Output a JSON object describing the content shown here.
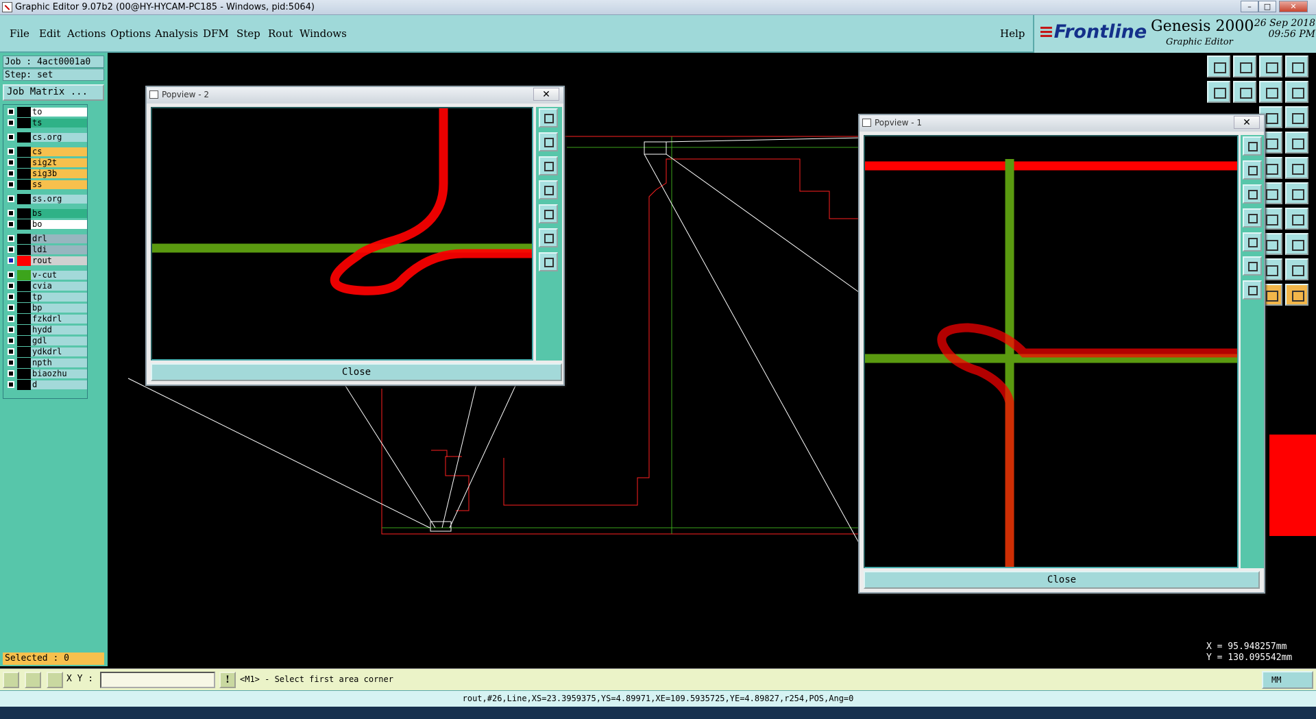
{
  "window": {
    "title": "Graphic Editor 9.07b2 (00@HY-HYCAM-PC185 - Windows, pid:5064)"
  },
  "menu": [
    "File",
    "Edit",
    "Actions",
    "Options",
    "Analysis",
    "DFM",
    "Step",
    "Rout",
    "Windows"
  ],
  "help_label": "Help",
  "branding": {
    "logo": "Frontline",
    "product": "Genesis 2000",
    "subtitle": "Graphic Editor",
    "date": "26 Sep 2018",
    "time": "09:56 PM"
  },
  "job": {
    "job_label": "Job : 4act0001a0",
    "step_label": "Step: set",
    "matrix_button": "Job Matrix ..."
  },
  "layers": [
    {
      "name": "to",
      "color": "#ffffff",
      "swatch": "#000000"
    },
    {
      "name": "ts",
      "color": "#2fb287",
      "swatch": "#000000"
    },
    {
      "name": "cs.org",
      "color": "#a3d9d9",
      "swatch": "#000000"
    },
    {
      "name": "cs",
      "color": "#f7c04d",
      "swatch": "#000000"
    },
    {
      "name": "sig2t",
      "color": "#f7c04d",
      "swatch": "#000000"
    },
    {
      "name": "sig3b",
      "color": "#f7c04d",
      "swatch": "#000000"
    },
    {
      "name": "ss",
      "color": "#f7c04d",
      "swatch": "#000000"
    },
    {
      "name": "ss.org",
      "color": "#a3d9d9",
      "swatch": "#000000"
    },
    {
      "name": "bs",
      "color": "#2fb287",
      "swatch": "#000000"
    },
    {
      "name": "bo",
      "color": "#ffffff",
      "swatch": "#000000"
    },
    {
      "name": "drl",
      "color": "#97b6bf",
      "swatch": "#000000"
    },
    {
      "name": "ldi",
      "color": "#97b6bf",
      "swatch": "#000000"
    },
    {
      "name": "rout",
      "color": "#d0d0d0",
      "swatch": "#ff0000",
      "active": true
    },
    {
      "name": "v-cut",
      "color": "#a3d9d9",
      "swatch": "#3ca41c"
    },
    {
      "name": "cvia",
      "color": "#a3d9d9",
      "swatch": "#000000"
    },
    {
      "name": "tp",
      "color": "#a3d9d9",
      "swatch": "#000000"
    },
    {
      "name": "bp",
      "color": "#a3d9d9",
      "swatch": "#000000"
    },
    {
      "name": "fzkdrl",
      "color": "#a3d9d9",
      "swatch": "#000000"
    },
    {
      "name": "hydd",
      "color": "#a3d9d9",
      "swatch": "#000000"
    },
    {
      "name": "gdl",
      "color": "#a3d9d9",
      "swatch": "#000000"
    },
    {
      "name": "ydkdrl",
      "color": "#a3d9d9",
      "swatch": "#000000"
    },
    {
      "name": "npth",
      "color": "#a3d9d9",
      "swatch": "#000000"
    },
    {
      "name": "biaozhu",
      "color": "#a3d9d9",
      "swatch": "#000000"
    },
    {
      "name": "d",
      "color": "#a3d9d9",
      "swatch": "#000000"
    }
  ],
  "selected_label": "Selected : 0",
  "popviews": {
    "pv2": {
      "title": "Popview - 2",
      "close": "Close",
      "x_btn": "✕"
    },
    "pv1": {
      "title": "Popview - 1",
      "close": "Close",
      "x_btn": "✕"
    }
  },
  "coordinates": {
    "x": "X = 95.948257mm",
    "y": "Y = 130.095542mm"
  },
  "command": {
    "xy_label": "X Y :",
    "xy_value": "",
    "prompt": "<M1> - Select first area corner",
    "units": "MM"
  },
  "status_line": "rout,#26,Line,XS=23.3959375,YS=4.89971,XE=109.5935725,YE=4.89827,r254,POS,Ang=0",
  "colors": {
    "rout": "#ff0000",
    "vcut": "#5a9a10",
    "panel": "#57c6aa",
    "menubar": "#9fd9d9"
  }
}
